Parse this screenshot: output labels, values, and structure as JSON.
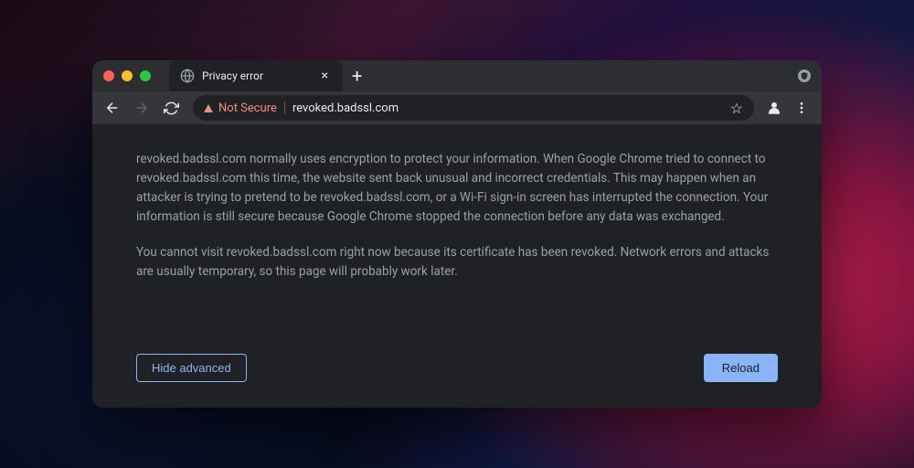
{
  "tab": {
    "title": "Privacy error"
  },
  "omnibox": {
    "security_label": "Not Secure",
    "url": "revoked.badssl.com"
  },
  "body": {
    "paragraph1": "revoked.badssl.com normally uses encryption to protect your information. When Google Chrome tried to connect to revoked.badssl.com this time, the website sent back unusual and incorrect credentials. This may happen when an attacker is trying to pretend to be revoked.badssl.com, or a Wi-Fi sign-in screen has interrupted the connection. Your information is still secure because Google Chrome stopped the connection before any data was exchanged.",
    "paragraph2": "You cannot visit revoked.badssl.com right now because its certificate has been revoked. Network errors and attacks are usually temporary, so this page will probably work later."
  },
  "buttons": {
    "hide_advanced": "Hide advanced",
    "reload": "Reload"
  }
}
